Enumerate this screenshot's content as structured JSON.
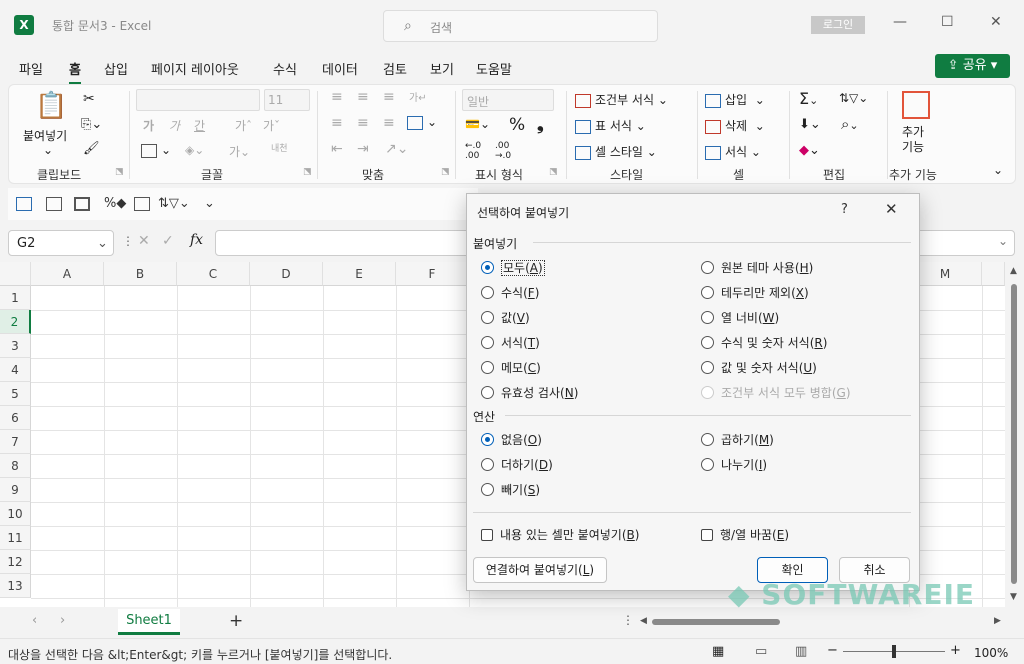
{
  "window": {
    "app_icon": "X",
    "title": "통합 문서3  -  Excel",
    "search_placeholder": "검색",
    "login": "로그인",
    "min": "—",
    "max": "☐",
    "close": "✕"
  },
  "tabs": [
    "파일",
    "홈",
    "삽입",
    "페이지 레이아웃",
    "수식",
    "데이터",
    "검토",
    "보기",
    "도움말"
  ],
  "share_label": "공유",
  "ribbon": {
    "clipboard": {
      "paste": "붙여넣기",
      "label": "클립보드"
    },
    "font": {
      "size": "11",
      "label": "글꼴",
      "b1": "가",
      "b2": "가",
      "b3": "간",
      "b4": "가ˆ",
      "b5": "가ˇ"
    },
    "align": {
      "label": "맞춤"
    },
    "number": {
      "format": "일반",
      "label": "표시 형식"
    },
    "styles": {
      "cond": "조건부 서식",
      "table": "표 서식",
      "cell": "셀 스타일",
      "label": "스타일"
    },
    "cells": {
      "insert": "삽입",
      "delete": "삭제",
      "format": "서식",
      "label": "셀"
    },
    "editing": {
      "label": "편집"
    },
    "addins": {
      "btn": "추가\n기능",
      "label": "추가 기능"
    }
  },
  "namebox": "G2",
  "columns": [
    "A",
    "B",
    "C",
    "D",
    "E",
    "F",
    "M"
  ],
  "rows": [
    "1",
    "2",
    "3",
    "4",
    "5",
    "6",
    "7",
    "8",
    "9",
    "10",
    "11",
    "12",
    "13"
  ],
  "sheet_tab": "Sheet1",
  "status": "대상을 선택한 다음 &lt;Enter&gt; 키를 누르거나 [붙여넣기]를 선택합니다.",
  "zoom": "100%",
  "dialog": {
    "title": "선택하여 붙여넣기",
    "help": "?",
    "close": "✕",
    "paste_section": "붙여넣기",
    "paste_left": [
      {
        "label": "모두",
        "key": "A",
        "on": true
      },
      {
        "label": "수식",
        "key": "F"
      },
      {
        "label": "값",
        "key": "V"
      },
      {
        "label": "서식",
        "key": "T"
      },
      {
        "label": "메모",
        "key": "C"
      },
      {
        "label": "유효성 검사",
        "key": "N"
      }
    ],
    "paste_right": [
      {
        "label": "원본 테마 사용",
        "key": "H"
      },
      {
        "label": "테두리만 제외",
        "key": "X"
      },
      {
        "label": "열 너비",
        "key": "W"
      },
      {
        "label": "수식 및 숫자 서식",
        "key": "R"
      },
      {
        "label": "값 및 숫자 서식",
        "key": "U"
      },
      {
        "label": "조건부 서식 모두 병합",
        "key": "G",
        "disabled": true
      }
    ],
    "op_section": "연산",
    "op_left": [
      {
        "label": "없음",
        "key": "O",
        "on": true
      },
      {
        "label": "더하기",
        "key": "D"
      },
      {
        "label": "빼기",
        "key": "S"
      }
    ],
    "op_right": [
      {
        "label": "곱하기",
        "key": "M"
      },
      {
        "label": "나누기",
        "key": "I"
      }
    ],
    "skip_blanks": {
      "label": "내용 있는 셀만 붙여넣기",
      "key": "B"
    },
    "transpose": {
      "label": "행/열 바꿈",
      "key": "E"
    },
    "paste_link": {
      "label": "연결하여 붙여넣기",
      "key": "L"
    },
    "ok": "확인",
    "cancel": "취소"
  },
  "watermark": "SOFTWAREIE"
}
